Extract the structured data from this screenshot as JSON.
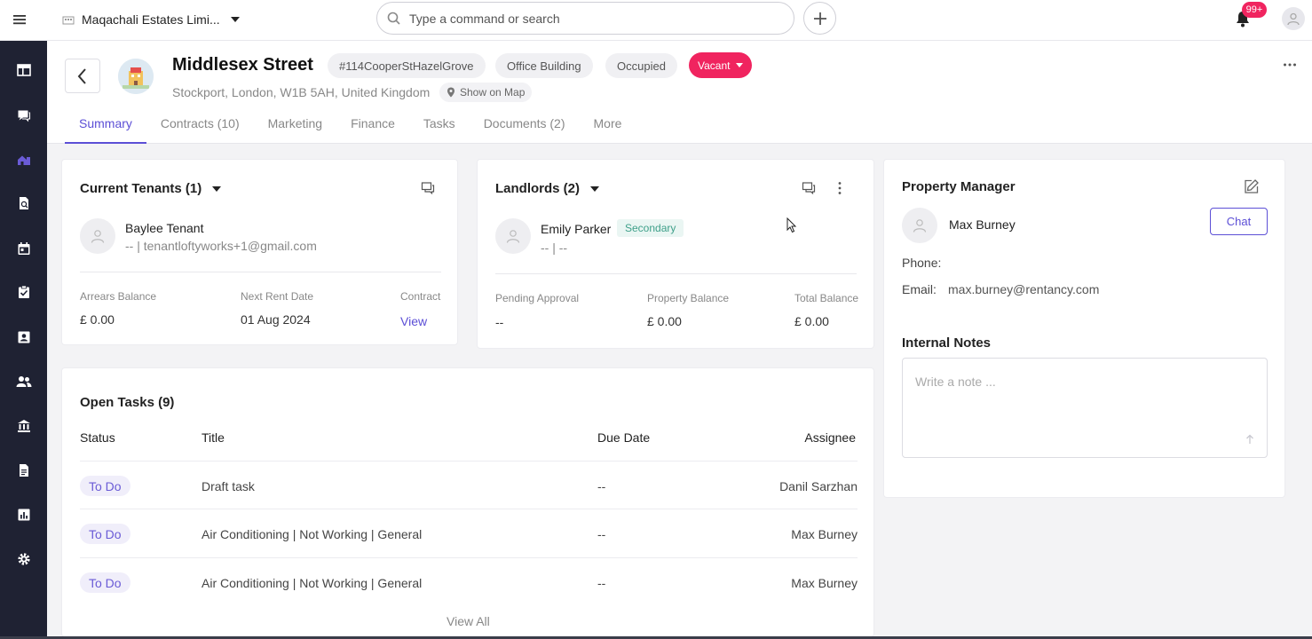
{
  "topbar": {
    "org_name": "Maqachali Estates Limi...",
    "search_placeholder": "Type a command or search",
    "notifications_badge": "99+"
  },
  "sidebar": {
    "items": [
      "dashboard-icon",
      "messages-icon",
      "properties-icon",
      "contacts-search-icon",
      "calendar-icon",
      "tasks-icon",
      "contacts-card-icon",
      "people-icon",
      "bank-icon",
      "documents-icon",
      "reports-icon",
      "settings-icon"
    ],
    "active_index": 2
  },
  "property": {
    "title": "Middlesex Street",
    "reference": "#114CooperStHazelGrove",
    "type": "Office Building",
    "occupancy": "Occupied",
    "status": "Vacant",
    "address": "Stockport, London, W1B 5AH, United Kingdom",
    "show_map": "Show on Map"
  },
  "tabs": [
    "Summary",
    "Contracts (10)",
    "Marketing",
    "Finance",
    "Tasks",
    "Documents (2)",
    "More"
  ],
  "tenants": {
    "title": "Current Tenants (1)",
    "name": "Baylee Tenant",
    "contact": "-- | tenantloftyworks+1@gmail.com",
    "arrears_label": "Arrears Balance",
    "arrears_value": "£ 0.00",
    "next_rent_label": "Next Rent Date",
    "next_rent_value": "01 Aug 2024",
    "contract_label": "Contract",
    "contract_link": "View"
  },
  "landlords": {
    "title": "Landlords (2)",
    "name": "Emily Parker",
    "tag": "Secondary",
    "contact": "-- | --",
    "pending_label": "Pending Approval",
    "pending_value": "--",
    "property_balance_label": "Property Balance",
    "property_balance_value": "£ 0.00",
    "total_balance_label": "Total Balance",
    "total_balance_value": "£ 0.00"
  },
  "tasks": {
    "title": "Open Tasks (9)",
    "columns": [
      "Status",
      "Title",
      "Due Date",
      "Assignee"
    ],
    "rows": [
      {
        "status": "To Do",
        "title": "Draft task",
        "due": "--",
        "assignee": "Danil Sarzhan"
      },
      {
        "status": "To Do",
        "title": "Air Conditioning | Not Working | General",
        "due": "--",
        "assignee": "Max Burney"
      },
      {
        "status": "To Do",
        "title": "Air Conditioning | Not Working | General",
        "due": "--",
        "assignee": "Max Burney"
      }
    ],
    "view_all": "View All"
  },
  "manager": {
    "title": "Property Manager",
    "name": "Max Burney",
    "chat_label": "Chat",
    "phone_label": "Phone:",
    "phone_value": "",
    "email_label": "Email:",
    "email_value": "max.burney@rentancy.com"
  },
  "notes": {
    "title": "Internal Notes",
    "placeholder": "Write a note ..."
  },
  "colors": {
    "accent": "#5c4fd6",
    "vacant": "#f0245f",
    "sidebar": "#1f2233"
  }
}
